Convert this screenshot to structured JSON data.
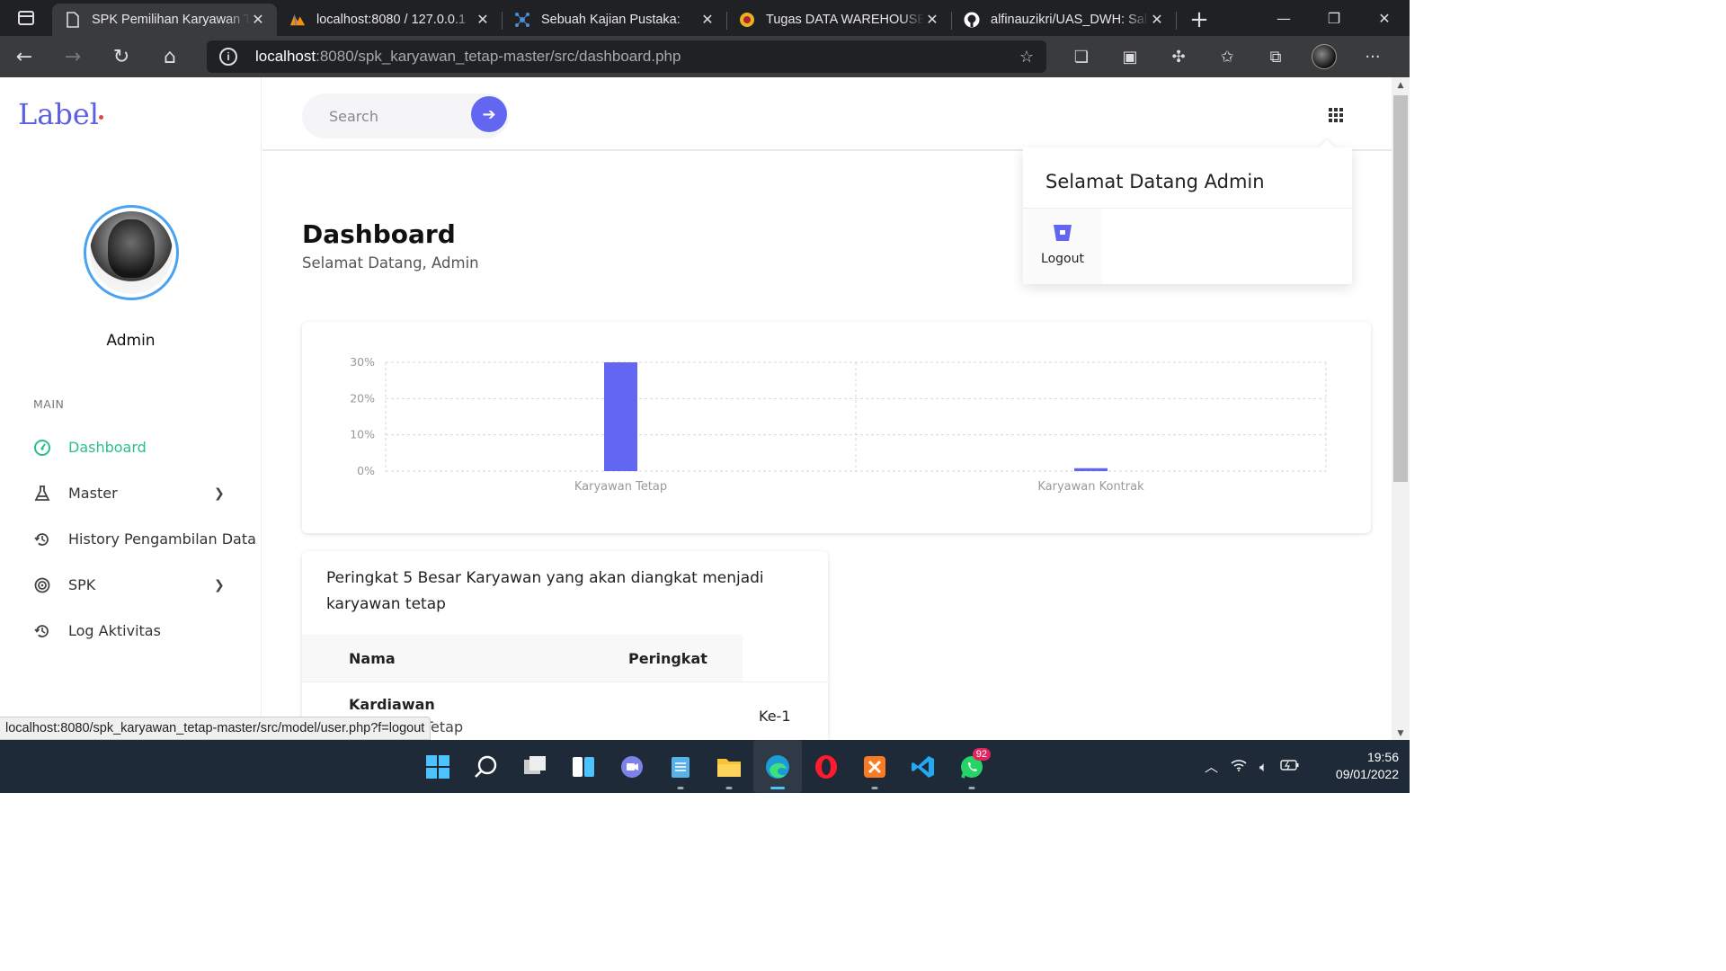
{
  "browser": {
    "tabs": [
      {
        "title": "SPK Pemilihan Karyawan Tetap",
        "active": true,
        "icon": "page-icon"
      },
      {
        "title": "localhost:8080 / 127.0.0.1",
        "active": false,
        "icon": "phpmyadmin-icon"
      },
      {
        "title": "Sebuah Kajian Pustaka:",
        "active": false,
        "icon": "network-icon"
      },
      {
        "title": "Tugas DATA WAREHOUSE",
        "active": false,
        "icon": "university-icon"
      },
      {
        "title": "alfinauzikri/UAS_DWH: Sal",
        "active": false,
        "icon": "github-icon"
      }
    ],
    "url_host": "localhost",
    "url_path": ":8080/spk_karyawan_tetap-master/src/dashboard.php",
    "status_url": "localhost:8080/spk_karyawan_tetap-master/src/model/user.php?f=logout"
  },
  "sidebar": {
    "logo": "Label",
    "profile_name": "Admin",
    "section_label": "MAIN",
    "items": [
      {
        "label": "Dashboard",
        "icon": "speedometer-icon",
        "active": true,
        "has_submenu": false
      },
      {
        "label": "Master",
        "icon": "flask-icon",
        "active": false,
        "has_submenu": true
      },
      {
        "label": "History Pengambilan Data",
        "icon": "history-icon",
        "active": false,
        "has_submenu": false
      },
      {
        "label": "SPK",
        "icon": "target-icon",
        "active": false,
        "has_submenu": true
      },
      {
        "label": "Log Aktivitas",
        "icon": "history-icon",
        "active": false,
        "has_submenu": false
      }
    ]
  },
  "topbar": {
    "search_placeholder": "Search"
  },
  "dropdown": {
    "title": "Selamat Datang Admin",
    "logout_label": "Logout"
  },
  "main": {
    "title": "Dashboard",
    "subtitle": "Selamat Datang, Admin"
  },
  "chart_data": {
    "type": "bar",
    "categories": [
      "Karyawan Tetap",
      "Karyawan Kontrak"
    ],
    "values": [
      30,
      0.8
    ],
    "ylim": [
      0,
      30
    ],
    "yticks": [
      "0%",
      "10%",
      "20%",
      "30%"
    ],
    "grid": true,
    "bar_color": "#6366f1"
  },
  "table": {
    "title": "Peringkat 5 Besar Karyawan yang akan diangkat menjadi karyawan tetap",
    "headers": [
      "Nama",
      "Peringkat"
    ],
    "rows": [
      {
        "name": "Kardiawan",
        "sub": "Karyawan Tetap",
        "rank": "Ke-1"
      }
    ]
  },
  "taskbar": {
    "time": "19:56",
    "date": "09/01/2022",
    "whatsapp_badge": "92"
  },
  "colors": {
    "accent": "#6366f1",
    "active_menu": "#2bbf8a"
  }
}
